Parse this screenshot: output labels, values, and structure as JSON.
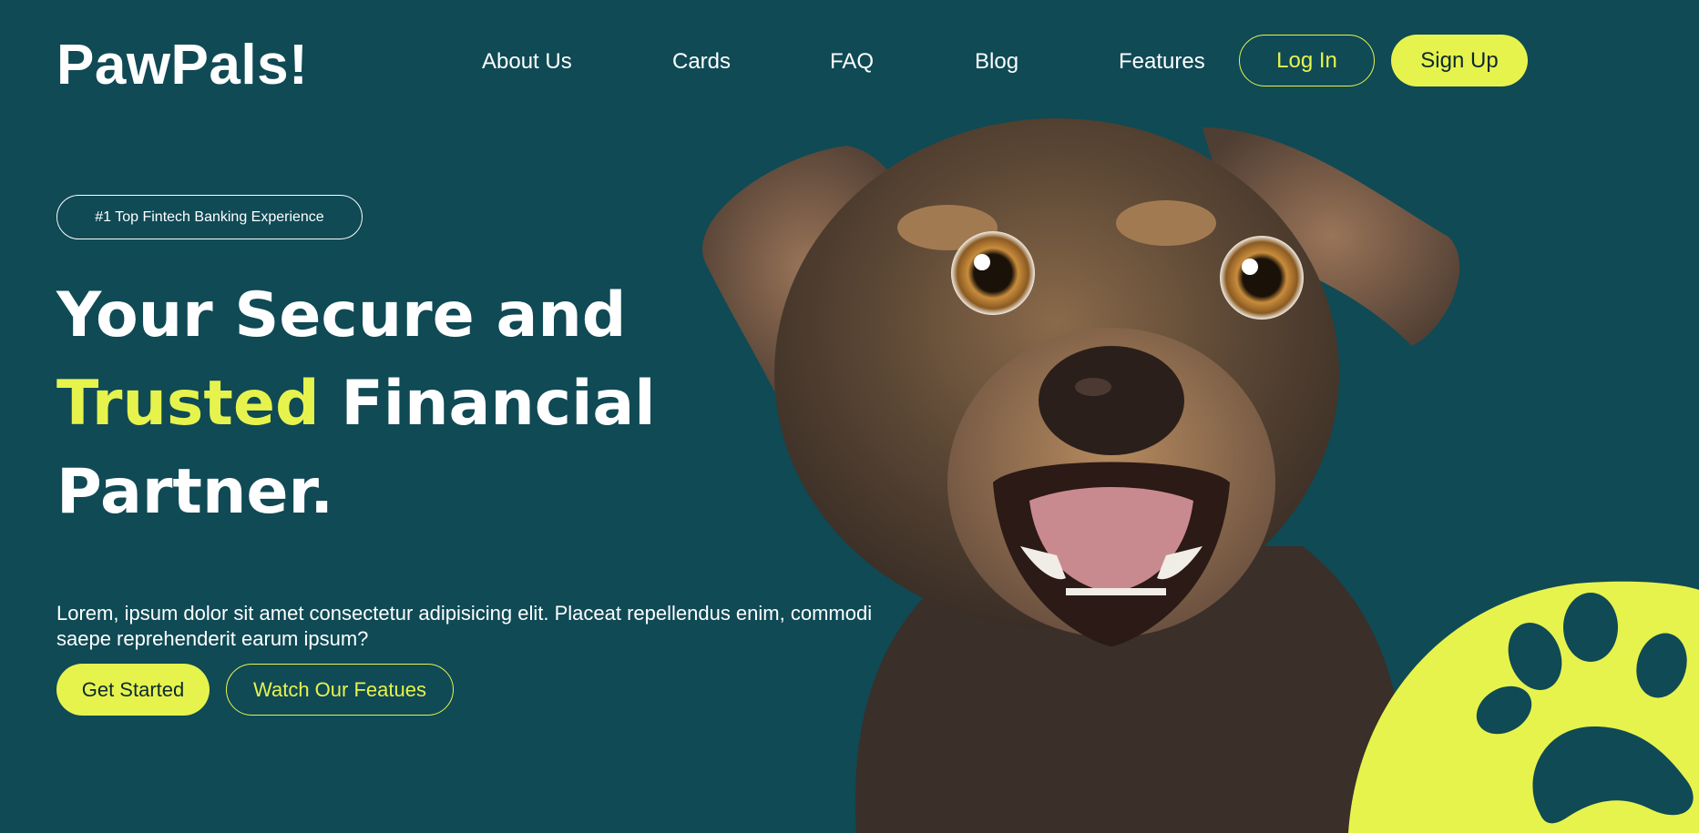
{
  "brand": {
    "logo": "PawPals!"
  },
  "nav": {
    "items": [
      {
        "label": "About Us"
      },
      {
        "label": "Cards"
      },
      {
        "label": "FAQ"
      },
      {
        "label": "Blog"
      },
      {
        "label": "Features"
      }
    ],
    "login_label": "Log In",
    "signup_label": "Sign Up"
  },
  "hero": {
    "badge": "#1 Top Fintech Banking Experience",
    "headline_part1": "Your Secure and",
    "headline_accent": "Trusted",
    "headline_part2": " Financial",
    "headline_part3": "Partner.",
    "description": "Lorem, ipsum dolor sit amet consectetur adipisicing elit. Placeat repellendus enim, commodi saepe reprehenderit earum ipsum?",
    "primary_cta": "Get Started",
    "secondary_cta": "Watch Our Featues"
  },
  "colors": {
    "background": "#0f4a55",
    "accent": "#e7f34d",
    "text": "#ffffff"
  },
  "icons": {
    "hero_image": "dog-photo",
    "decoration": "paw-icon"
  }
}
